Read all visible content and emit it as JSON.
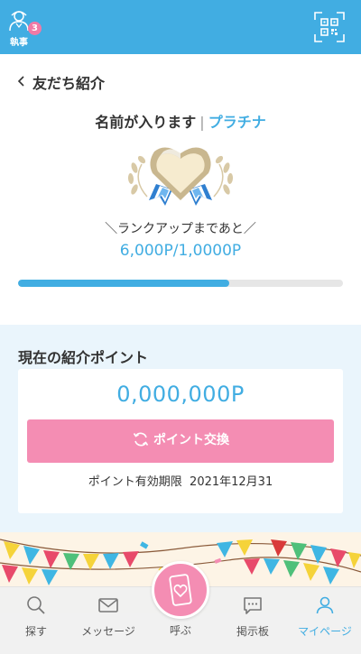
{
  "header": {
    "butler_label": "執事",
    "butler_badge": "3",
    "icons": {
      "butler": "butler-icon",
      "qr": "qr-code-icon"
    }
  },
  "page": {
    "title": "友だち紹介"
  },
  "rank": {
    "name": "名前が入ります",
    "separator": "|",
    "level": "プラチナ",
    "rankup_label": "＼ランクアップまであと／",
    "progress_text": "6,000P/1,0000P",
    "progress_fraction": 0.65
  },
  "points": {
    "heading": "現在の紹介ポイント",
    "value": "0,000,000P",
    "exchange_label": "ポイント交換",
    "expiry_label": "ポイント有効期限",
    "expiry_date": "2021年12月31"
  },
  "nav": {
    "items": [
      {
        "label": "探す",
        "icon": "search-icon"
      },
      {
        "label": "メッセージ",
        "icon": "mail-icon"
      },
      {
        "label": "呼ぶ",
        "icon": "phone-heart-icon"
      },
      {
        "label": "掲示板",
        "icon": "chat-bubble-icon"
      },
      {
        "label": "マイページ",
        "icon": "person-icon"
      }
    ],
    "active": "マイページ"
  },
  "colors": {
    "primary": "#41ade2",
    "accent": "#f48db3",
    "section_bg": "#eaf5fc"
  }
}
